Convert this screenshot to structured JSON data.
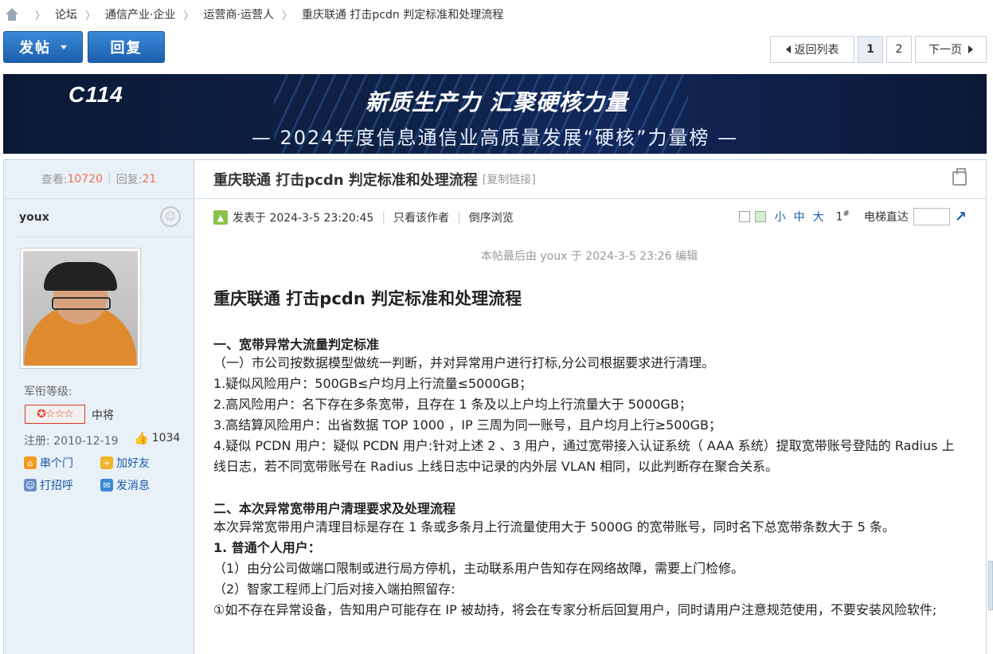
{
  "breadcrumb": {
    "items": [
      "论坛",
      "通信产业·企业",
      "运营商·运营人",
      "重庆联通 打击pcdn 判定标准和处理流程"
    ]
  },
  "actions": {
    "post_label": "发帖",
    "reply_label": "回复"
  },
  "pager": {
    "back_label": "返回列表",
    "pages": [
      "1",
      "2"
    ],
    "current_page": "1",
    "next_label": "下一页"
  },
  "banner": {
    "logo_text": "C114",
    "slogan": "新质生产力 汇聚硬核力量",
    "subtitle": "— 2024年度信息通信业高质量发展“硬核”力量榜 —"
  },
  "sidebar": {
    "views_label": "查看:",
    "views": "10720",
    "replies_label": "回复:",
    "replies": "21",
    "username": "youx",
    "rank_label": "军衔等级:",
    "rank_name": "中将",
    "register": "注册:  2010-12-19",
    "likes": "1034",
    "links": [
      "串个门",
      "加好友",
      "打招呼",
      "发消息"
    ]
  },
  "post": {
    "title": "重庆联通 打击pcdn 判定标准和处理流程",
    "copy_link": "[复制链接]",
    "posted_at": "发表于 2024-3-5 23:20:45",
    "author_only": "只看该作者",
    "reverse": "倒序浏览",
    "size_small": "小",
    "size_medium": "中",
    "size_large": "大",
    "floor": "1",
    "floor_mark": "#",
    "jump_label": "电梯直达",
    "edit_note": "本帖最后由 youx 于 2024-3-5 23:26 编辑",
    "article_title": "重庆联通 打击pcdn 判定标准和处理流程",
    "section1_title": "一、宽带异常大流量判定标准",
    "section1_lines": [
      "（一）市公司按数据模型做统一判断，并对异常用户进行打标,分公司根据要求进行清理。",
      "1.疑似风险用户：500GB≤户均月上行流量≤5000GB；",
      "2.高风险用户：名下存在多条宽带，且存在 1 条及以上户均上行流量大于 5000GB；",
      "3.高结算风险用户：出省数据 TOP 1000 ，IP 三周为同一账号，且户均月上行≥500GB；",
      "4.疑似 PCDN 用户：疑似 PCDN 用户:针对上述 2 、3 用户，通过宽带接入认证系统（ AAA 系统）提取宽带账号登陆的 Radius 上线日志，若不同宽带账号在 Radius 上线日志中记录的内外层 VLAN 相同，以此判断存在聚合关系。"
    ],
    "section2_title": "二、本次异常宽带用户清理要求及处理流程",
    "section2_intro": "本次异常宽带用户清理目标是存在 1 条或多条月上行流量使用大于 5000G 的宽带账号，同时名下总宽带条数大于 5 条。",
    "section2_sub1": "1. 普通个人用户：",
    "section2_lines": [
      "（1）由分公司做端口限制或进行局方停机，主动联系用户告知存在网络故障，需要上门检修。",
      "（2）智家工程师上门后对接入端拍照留存:",
      "①如不存在异常设备，告知用户可能存在 IP 被劫持，将会在专家分析后回复用户，同时请用户注意规范使用，不要安装风险软件;"
    ]
  }
}
